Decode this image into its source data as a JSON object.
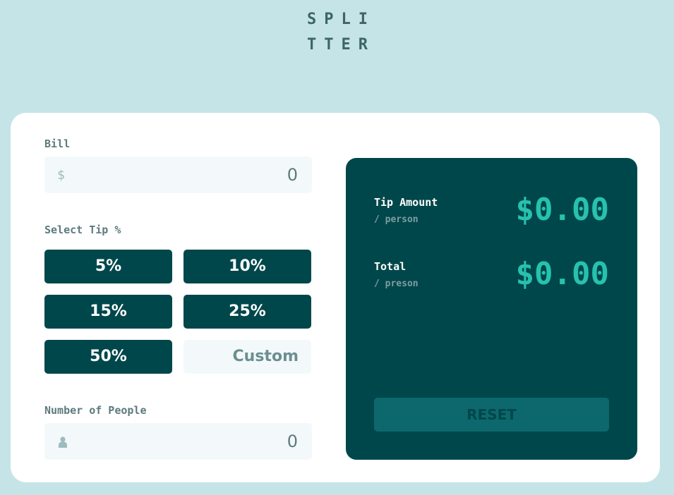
{
  "logo": {
    "line1": "SPLI",
    "line2": "TTER"
  },
  "bill": {
    "label": "Bill",
    "currency_icon": "$",
    "value": "0"
  },
  "tip": {
    "label": "Select Tip %",
    "options": [
      "5%",
      "10%",
      "15%",
      "25%",
      "50%"
    ],
    "custom_placeholder": "Custom"
  },
  "people": {
    "label": "Number of People",
    "value": "0"
  },
  "results": {
    "tip_amount": {
      "label": "Tip Amount",
      "sub": "/ person",
      "value": "$0.00"
    },
    "total": {
      "label": "Total",
      "sub": "/ preson",
      "value": "$0.00"
    },
    "reset_label": "RESET"
  },
  "colors": {
    "background": "#c5e4e7",
    "dark_cyan": "#00474b",
    "accent": "#26c2ae",
    "input_bg": "#f3f9fa"
  }
}
